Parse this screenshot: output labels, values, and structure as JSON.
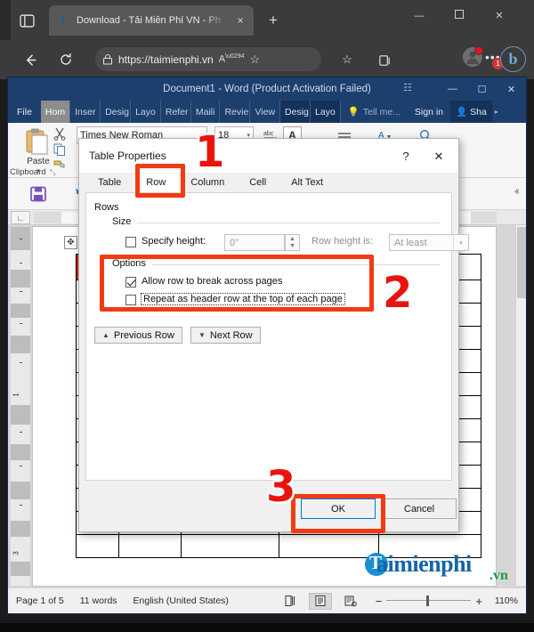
{
  "browser": {
    "tab": {
      "favicon": "taimienphi-t-icon",
      "title": "Download - Tải Miễn Phí VN - Ph",
      "close": "×"
    },
    "new_tab": "+",
    "window_controls": {
      "minimize": "—",
      "maximize": "❑",
      "close": "✕"
    },
    "toolbar": {
      "back": "←",
      "refresh": "⟳",
      "lock": "lock-icon",
      "url": "https://taimienphi.vn",
      "read_aloud": "A",
      "favorite_add": "☆",
      "favorites": "☆",
      "collections": "collections-icon",
      "profile": "profile-icon",
      "more": "•••",
      "more_badge": "1",
      "copilot": "b"
    }
  },
  "word": {
    "title": "Document1 - Word (Product Activation Failed)",
    "window_controls": {
      "ribbon_options": "☷",
      "minimize": "—",
      "maximize": "☐",
      "close": "✕"
    },
    "tabs": [
      {
        "label": "File",
        "state": "file"
      },
      {
        "label": "Hom",
        "state": "active"
      },
      {
        "label": "Inser",
        "state": "normal"
      },
      {
        "label": "Desig",
        "state": "normal"
      },
      {
        "label": "Layo",
        "state": "normal"
      },
      {
        "label": "Refer",
        "state": "normal"
      },
      {
        "label": "Maili",
        "state": "normal"
      },
      {
        "label": "Revie",
        "state": "normal"
      },
      {
        "label": "View",
        "state": "normal"
      },
      {
        "label": "Desig",
        "state": "context"
      },
      {
        "label": "Layo",
        "state": "context"
      }
    ],
    "tell_me": "Tell me...",
    "sign_in": "Sign in",
    "share": "Sha",
    "overflow_arrow": "▸",
    "ribbon": {
      "paste_label": "Paste",
      "paste_caret": "▾",
      "clipboard_group": "Clipboard",
      "clipboard_dialog_launcher": "⤡",
      "font_name": "Times New Roman",
      "font_size": "18",
      "font_size_caret": "▾",
      "clear_formatting": "abc",
      "text_effects": "A",
      "align": "≡",
      "text_highlight": "A",
      "font_color": "A",
      "find": "⌕"
    },
    "quick_access": {
      "save": "save-icon",
      "undo": "↶"
    },
    "ribbon_collapse": "ⱏ",
    "status": {
      "page": "Page 1 of 5",
      "words": "11 words",
      "language": "English (United States)",
      "proofing": "proofing-icon",
      "view_read": "read-mode-icon",
      "view_print": "print-layout-icon",
      "view_web": "web-layout-icon",
      "zoom_out": "−",
      "zoom_in": "+",
      "zoom_level": "110%"
    },
    "watermark": {
      "t": "T",
      "name": "aimienphi",
      "tld": ".vn"
    }
  },
  "dialog": {
    "title": "Table Properties",
    "help": "?",
    "close": "✕",
    "tabs": [
      {
        "label": "Table",
        "active": false
      },
      {
        "label": "Row",
        "active": true
      },
      {
        "label": "Column",
        "active": false
      },
      {
        "label": "Cell",
        "active": false
      },
      {
        "label": "Alt Text",
        "active": false
      }
    ],
    "rows_label": "Rows",
    "size": {
      "group_label": "Size",
      "specify_height_label": "Specify height:",
      "specify_height_checked": false,
      "height_value": "0\"",
      "row_height_is_label": "Row height is:",
      "row_height_value": "At least",
      "spin_up": "▲",
      "spin_down": "▼",
      "combo_arrow": "▾"
    },
    "options": {
      "group_label": "Options",
      "items": [
        {
          "label": "Allow row to break across pages",
          "checked": true,
          "focused": false
        },
        {
          "label": "Repeat as header row at the top of each page",
          "checked": false,
          "focused": true
        }
      ]
    },
    "nav": {
      "previous": "Previous Row",
      "previous_icon": "▲",
      "next": "Next Row",
      "next_icon": "▼"
    },
    "footer": {
      "ok": "OK",
      "cancel": "Cancel"
    }
  },
  "annotations": {
    "colors": {
      "highlight": "#f23a13",
      "number": "#e8140c"
    },
    "steps": [
      {
        "number": "1"
      },
      {
        "number": "2"
      },
      {
        "number": "3"
      }
    ]
  }
}
